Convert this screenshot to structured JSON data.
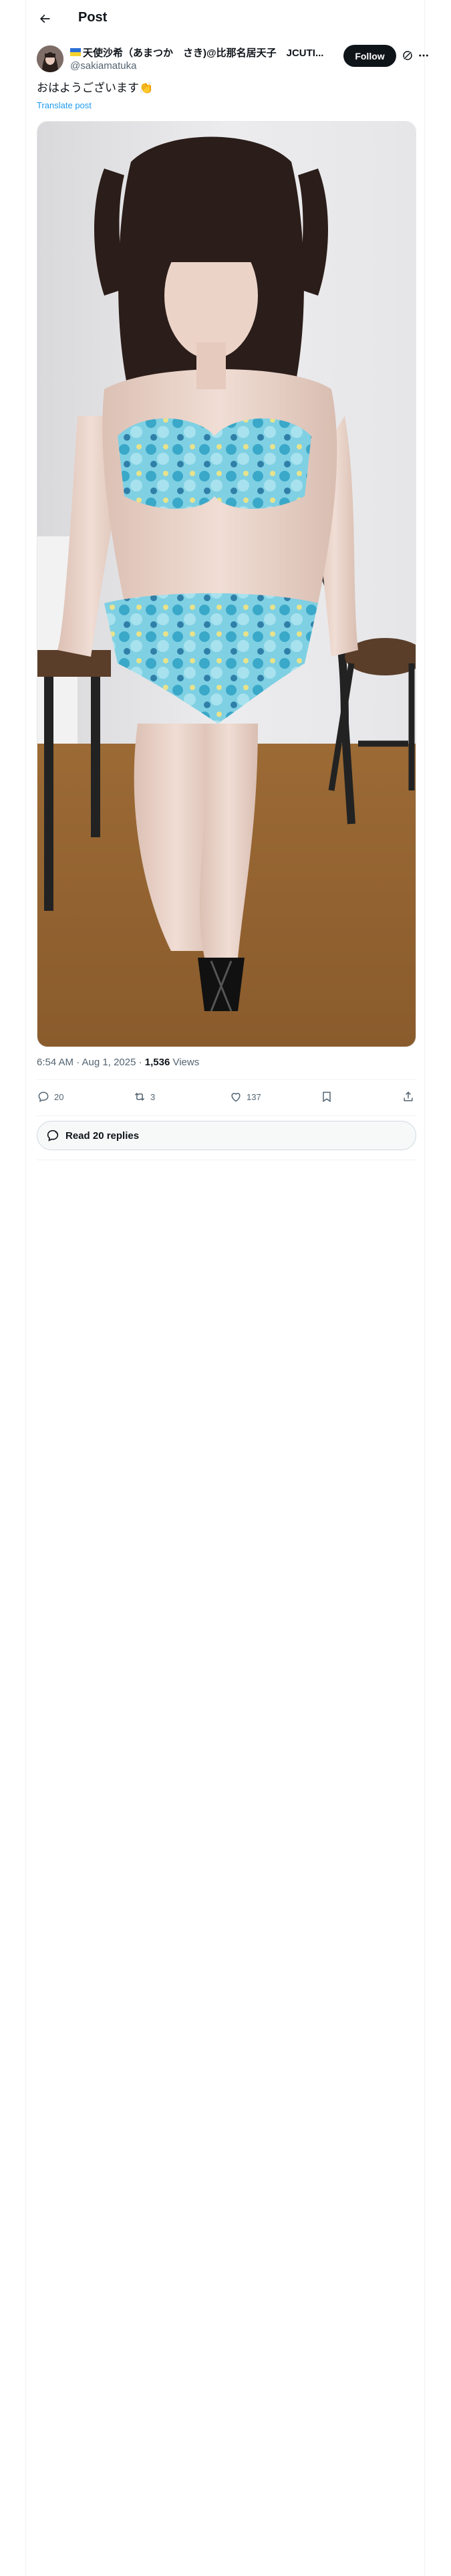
{
  "header": {
    "title": "Post",
    "back_icon": "arrow-left-icon"
  },
  "post": {
    "author_name": "天使沙希（あまつか　さき)@比那名居天子　JCUTI...",
    "author_handle": "@sakiamatuka",
    "follow_label": "Follow",
    "text": "おはようございます👏",
    "translate_label": "Translate post",
    "time": "6:54 AM · Aug 1, 2025 · ",
    "views_count": "1,536",
    "views_label": " Views"
  },
  "actions": {
    "reply_count": "20",
    "repost_count": "3",
    "like_count": "137"
  },
  "replies": {
    "label": "Read 20 replies"
  },
  "colors": {
    "accent": "#1d9bf0",
    "text": "#0f1419",
    "muted": "#536471",
    "follow_bg": "#0f1419"
  }
}
